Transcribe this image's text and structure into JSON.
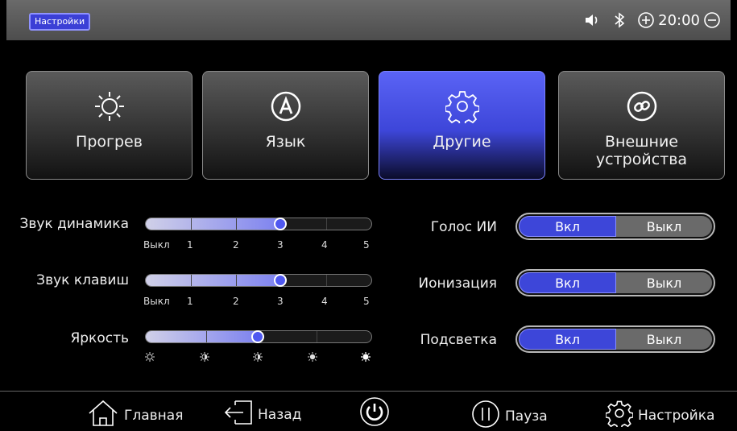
{
  "header": {
    "title": "Настройки",
    "time": "20:00",
    "icons": [
      "speaker-icon",
      "bluetooth-icon",
      "plus-circle-icon",
      "minus-circle-icon"
    ]
  },
  "tabs": [
    {
      "label": "Прогрев",
      "icon": "sun-icon",
      "active": false
    },
    {
      "label": "Язык",
      "icon": "language-a-icon",
      "active": false
    },
    {
      "label": "Другие",
      "icon": "gear-icon",
      "active": true
    },
    {
      "label_line1": "Внешние",
      "label_line2": "устройства",
      "icon": "link-icon",
      "active": false
    }
  ],
  "sliders": [
    {
      "label": "Звук динамика",
      "value": 3,
      "scale": [
        "Выкл",
        "1",
        "2",
        "3",
        "4",
        "5"
      ]
    },
    {
      "label": "Звук клавиш",
      "value": 3,
      "scale": [
        "Выкл",
        "1",
        "2",
        "3",
        "4",
        "5"
      ]
    },
    {
      "label": "Яркость",
      "value": 3,
      "scale_icons": [
        "brightness-1-icon",
        "brightness-2-icon",
        "brightness-3-icon",
        "brightness-4-icon",
        "brightness-5-icon"
      ]
    }
  ],
  "toggles": [
    {
      "label": "Голос ИИ",
      "on": "Вкл",
      "off": "Выкл",
      "selected": "Вкл"
    },
    {
      "label": "Ионизация",
      "on": "Вкл",
      "off": "Выкл",
      "selected": "Вкл"
    },
    {
      "label": "Подсветка",
      "on": "Вкл",
      "off": "Выкл",
      "selected": "Вкл"
    }
  ],
  "bottom": {
    "home": "Главная",
    "back": "Назад",
    "pause": "Пауза",
    "settings": "Настройка"
  },
  "colors": {
    "accent": "#3d46d9",
    "accent_light": "#7d82f0"
  }
}
